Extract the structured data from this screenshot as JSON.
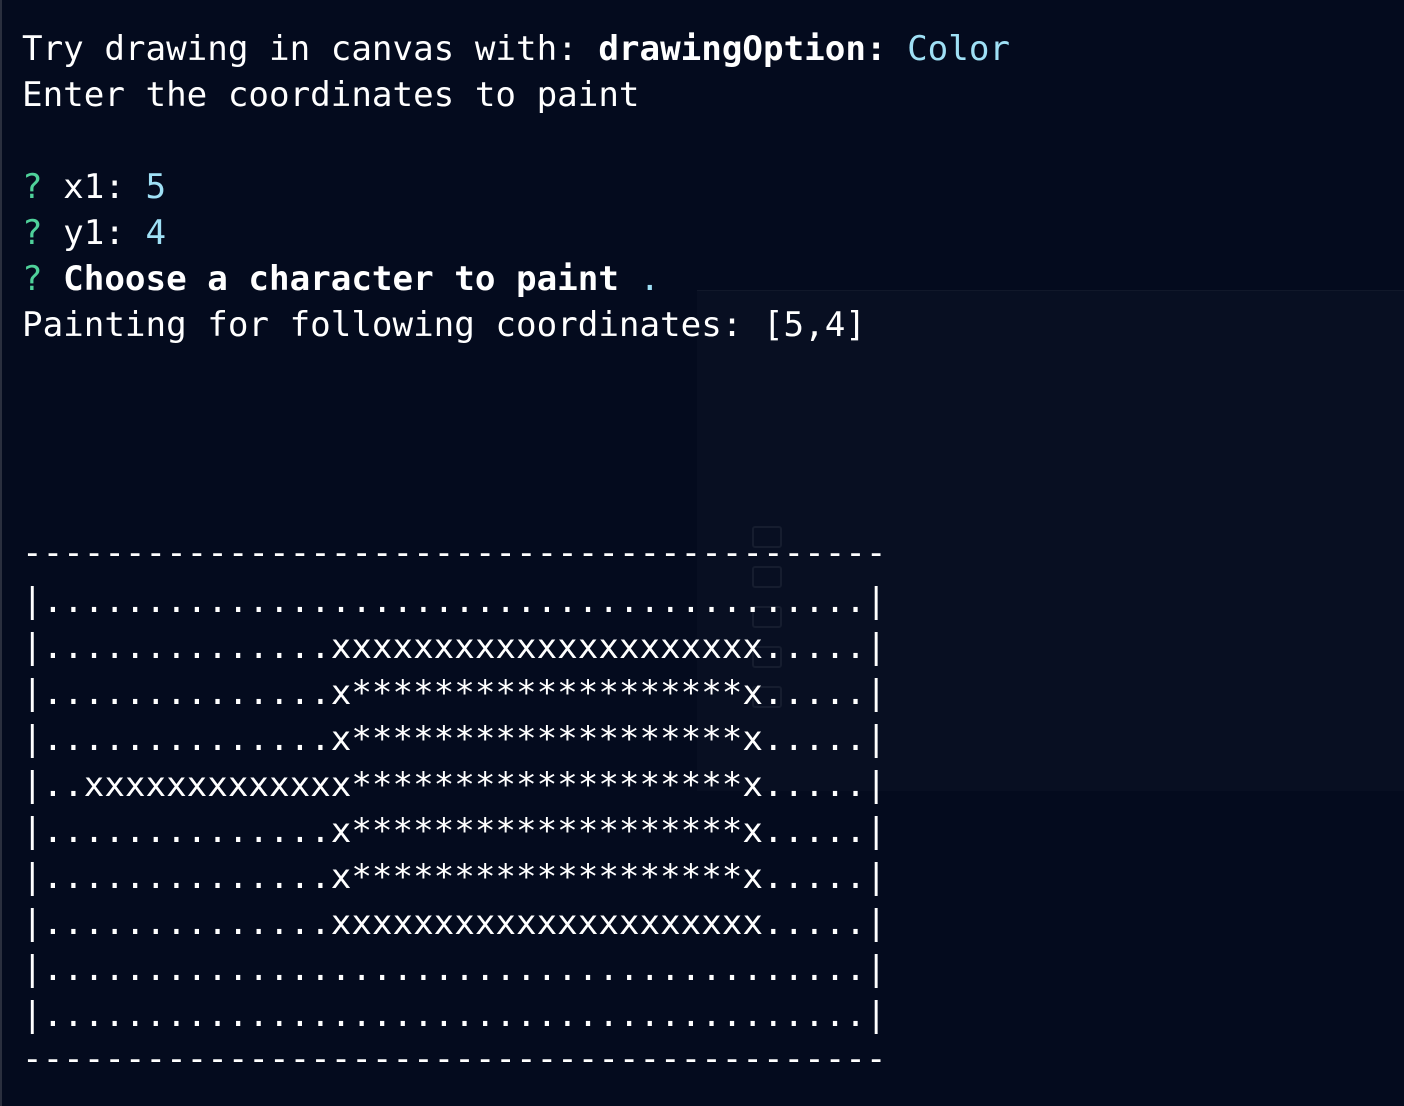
{
  "terminal": {
    "header": {
      "prefix": "Try drawing in canvas with: ",
      "option_key": "drawingOption:",
      "option_value": " Color"
    },
    "instruction": "Enter the coordinates to paint",
    "prompts": [
      {
        "marker": "?",
        "label": " x1: ",
        "value": "5"
      },
      {
        "marker": "?",
        "label": " y1: ",
        "value": "4"
      },
      {
        "marker": "?",
        "label": " Choose a character to paint ",
        "value": "."
      }
    ],
    "result": "Painting for following coordinates: [5,4]",
    "canvas": {
      "border_top": "------------------------------------------",
      "rows": [
        "|........................................|",
        "|..............xxxxxxxxxxxxxxxxxxxxx.....|",
        "|..............x*******************x.....|",
        "|..............x*******************x.....|",
        "|..xxxxxxxxxxxxx*******************x.....|",
        "|..............x*******************x.....|",
        "|..............x*******************x.....|",
        "|..............xxxxxxxxxxxxxxxxxxxxx.....|",
        "|........................................|",
        "|........................................|"
      ],
      "border_bottom": "------------------------------------------"
    }
  },
  "colors": {
    "background": "#040b1e",
    "text": "#ffffff",
    "prompt_marker": "#4fd19a",
    "value": "#9fe0f5"
  }
}
